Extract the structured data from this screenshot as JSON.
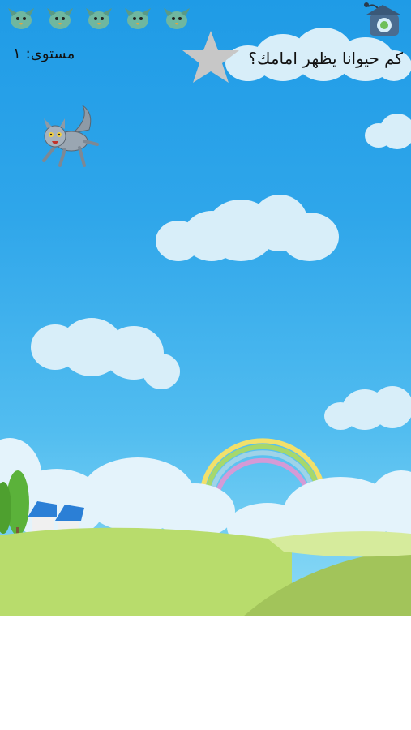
{
  "game": {
    "question": "كم حيوانا يظهر امامك؟",
    "level_label": "مستوى:",
    "level_value": "١",
    "lives": 5
  },
  "icons": {
    "lives": "bird-life-icon",
    "home": "home-pot-icon",
    "star": "star-icon",
    "animal": "wolf-character"
  },
  "colors": {
    "sky_top": "#1f9be6",
    "sky_bottom": "#8fdcf5",
    "cloud": "#d8eef9",
    "star": "#c7c7c7",
    "grass": "#b6dc6e"
  }
}
